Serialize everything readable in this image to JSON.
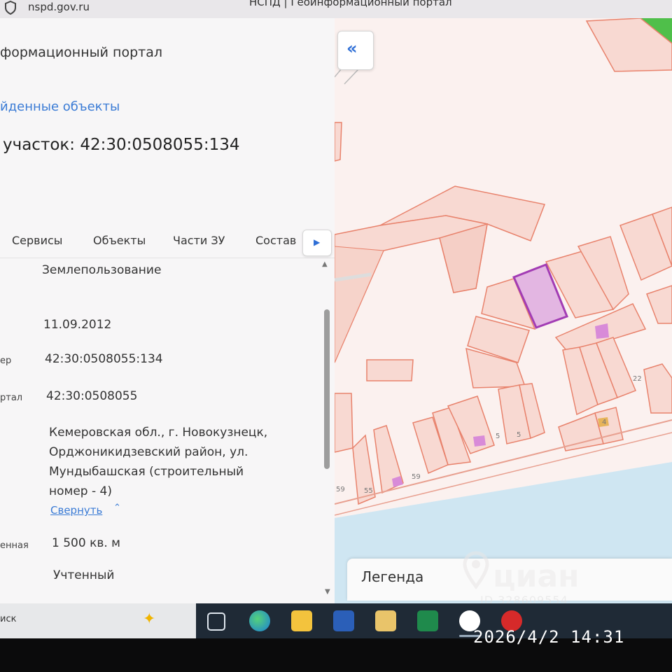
{
  "browser": {
    "url": "nspd.gov.ru",
    "tab_title": "НСПД | Геоинформационный портал",
    "shield_icon": "shield-icon"
  },
  "panel": {
    "portal_title": "формационный портал",
    "found_objects_link": "йденные объекты",
    "parcel_title": "участок: 42:30:0508055:134",
    "tabs": [
      "Сервисы",
      "Объекты",
      "Части ЗУ",
      "Состав"
    ],
    "tab_next_icon": "chevron-right-icon",
    "rows": {
      "land_use": "Землепользование",
      "date": "11.09.2012",
      "number_label": "ер",
      "number_value": "42:30:0508055:134",
      "quarter_label": "ртал",
      "quarter_value": "42:30:0508055",
      "address_lines": [
        "Кемеровская обл., г. Новокузнецк,",
        "Орджоникидзевский район, ул.",
        "Мундыбашская (строительный",
        "номер - 4)"
      ],
      "collapse_link": "Свернуть",
      "area_label": "енная",
      "area_value": "1 500 кв. м",
      "status": "Учтенный"
    }
  },
  "map": {
    "collapse_panel_icon": "double-chevron-left-icon",
    "legend_label": "Легенда",
    "parcel_numbers": [
      "22",
      "4",
      "5",
      "5",
      "59",
      "55",
      "59"
    ],
    "colors": {
      "parcel_fill": "#f8d9d2",
      "parcel_stroke": "#e8826c",
      "selected_stroke": "#a23cb4",
      "selected_fill": "#e3b6e2",
      "water": "#cfe6f2",
      "green": "#4fbf4a"
    }
  },
  "watermark": {
    "word": "циан",
    "id": "ID 328609554"
  },
  "taskbar": {
    "search_text": "иск",
    "icons": [
      "task-view-icon",
      "edge-browser-icon",
      "file-explorer-icon",
      "word-icon",
      "mail-icon",
      "excel-icon",
      "yandex-browser-icon",
      "app-icon"
    ]
  },
  "photo_timestamp": "2026/4/2 14:31"
}
